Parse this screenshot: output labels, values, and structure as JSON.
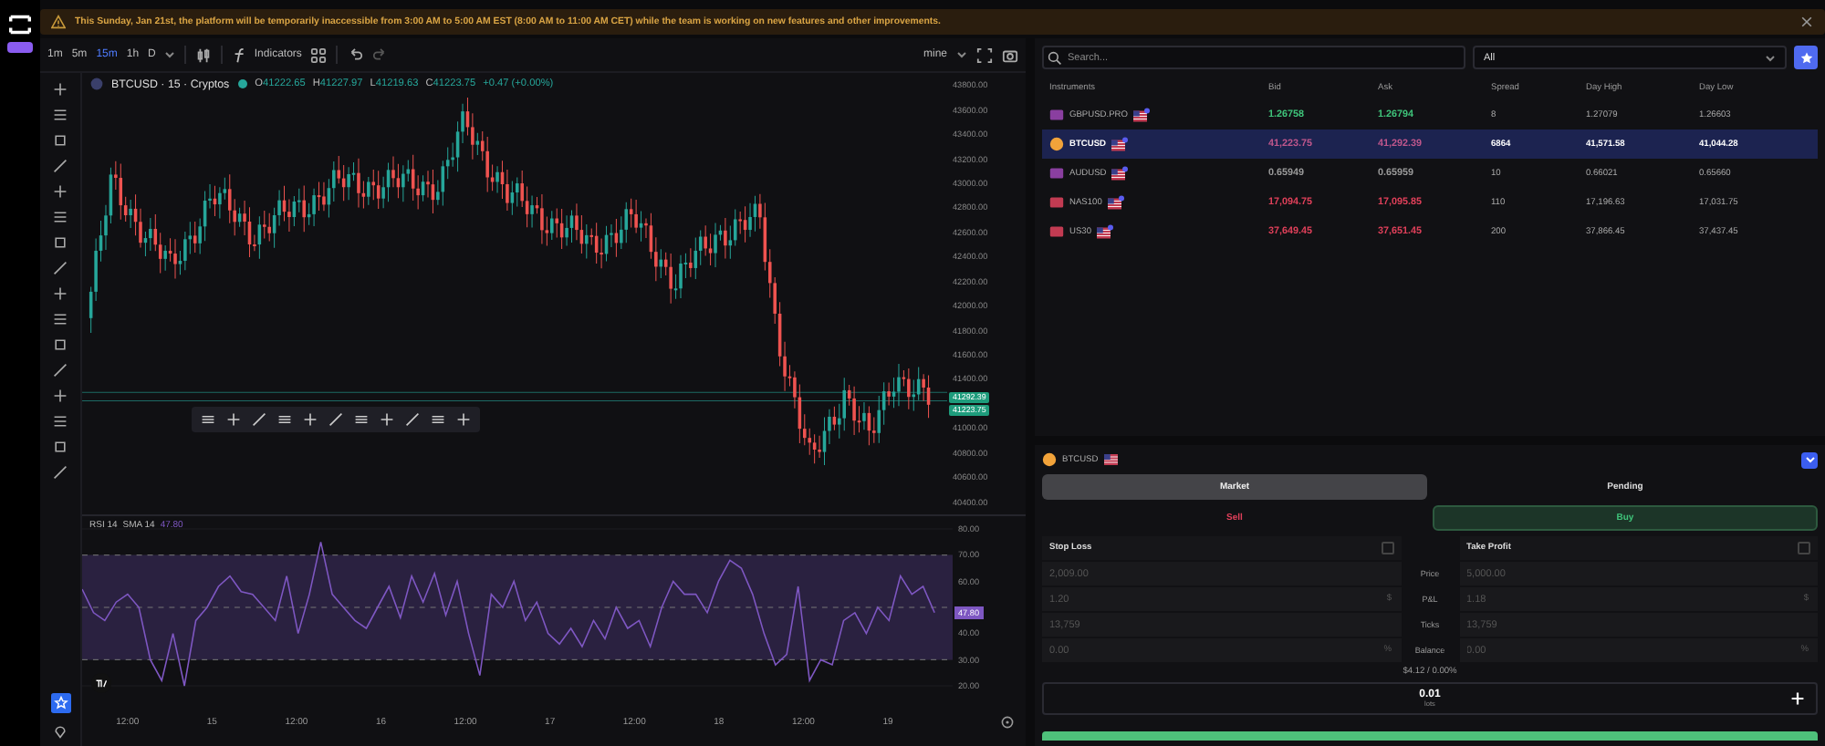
{
  "banner": {
    "message": "This Sunday, Jan 21st, the platform will be temporarily inaccessible from 3:00 AM to 5:00 AM EST (8:00 AM to 11:00 AM CET) while the team is working on new features and other improvements."
  },
  "chart": {
    "timeframes": [
      {
        "label": "1m",
        "selected": false
      },
      {
        "label": "5m",
        "selected": false
      },
      {
        "label": "15m",
        "selected": true
      },
      {
        "label": "1h",
        "selected": false
      },
      {
        "label": "D",
        "selected": false
      }
    ],
    "indicators_label": "Indicators",
    "chart_type": "mine",
    "symbol": "BTCUSD · 15 · Cryptos",
    "ohlc": [
      {
        "key": "O",
        "value": "41222.65"
      },
      {
        "key": "H",
        "value": "41227.97"
      },
      {
        "key": "L",
        "value": "41219.63"
      },
      {
        "key": "C",
        "value": "41223.75"
      }
    ],
    "change": "+0.47 (+0.00%)",
    "price_axis": [
      {
        "kind": "tick",
        "label": "43800.00"
      },
      {
        "kind": "tick",
        "label": "43600.00"
      },
      {
        "kind": "tick",
        "label": "43400.00"
      },
      {
        "kind": "tick",
        "label": "43200.00"
      },
      {
        "kind": "tick",
        "label": "43000.00"
      },
      {
        "kind": "tick",
        "label": "42800.00"
      },
      {
        "kind": "tick",
        "label": "42600.00"
      },
      {
        "kind": "tick",
        "label": "42400.00"
      },
      {
        "kind": "tick",
        "label": "42200.00"
      },
      {
        "kind": "tick",
        "label": "42000.00"
      },
      {
        "kind": "tick",
        "label": "41800.00"
      },
      {
        "kind": "tick",
        "label": "41600.00"
      },
      {
        "kind": "tick",
        "label": "41400.00"
      },
      {
        "kind": "price_tag",
        "label": "41292.39"
      },
      {
        "kind": "price_tag",
        "label": "41223.75"
      },
      {
        "kind": "tick",
        "label": "41000.00"
      },
      {
        "kind": "tick",
        "label": "40800.00"
      },
      {
        "kind": "tick",
        "label": "40600.00"
      },
      {
        "kind": "tick",
        "label": "40400.00"
      }
    ],
    "rsi": {
      "label": "SMA 14",
      "value": "47.80",
      "tag": "47.80",
      "chart_data": {
        "type": "line",
        "grid": true,
        "ylim": [
          20,
          80
        ],
        "yticks": [
          {
            "value": 80,
            "label": "80.00"
          },
          {
            "value": 70,
            "label": "70.00"
          },
          {
            "value": 60,
            "label": "60.00"
          },
          {
            "value": 40,
            "label": "40.00"
          },
          {
            "value": 30,
            "label": "30.00"
          },
          {
            "value": 20,
            "label": "20.00"
          }
        ],
        "series": [
          {
            "name": "RSI 14",
            "color": "#7e57c2",
            "values": [
              57,
              48,
              45,
              52,
              55,
              50,
              30,
              22,
              40,
              20,
              45,
              50,
              58,
              62,
              56,
              55,
              50,
              45,
              62,
              40,
              55,
              75,
              55,
              50,
              45,
              42,
              50,
              58,
              46,
              62,
              52,
              63,
              47,
              60,
              40,
              24,
              55,
              50,
              60,
              45,
              52,
              40,
              36,
              42,
              35,
              45,
              38,
              50,
              42,
              45,
              35,
              50,
              60,
              55,
              55,
              48,
              60,
              68,
              65,
              55,
              40,
              28,
              32,
              58,
              22,
              30,
              28,
              45,
              48,
              40,
              50,
              45,
              62,
              55,
              58,
              48
            ]
          }
        ]
      }
    },
    "time_axis": [
      "12:00",
      "15",
      "12:00",
      "16",
      "12:00",
      "17",
      "12:00",
      "18",
      "12:00",
      "19"
    ]
  },
  "instruments": {
    "search_placeholder": "Search...",
    "filter": "All",
    "columns": [
      "Instruments",
      "Bid",
      "Ask",
      "Spread",
      "Day High",
      "Day Low"
    ],
    "rows": [
      {
        "symbol": "GBPUSD.PRO",
        "kind": "forex",
        "color": "#3fc47a",
        "bid": "1.26758",
        "ask": "1.26794",
        "spread": "8",
        "day_high": "1.27079",
        "day_low": "1.26603",
        "selected": false
      },
      {
        "symbol": "BTCUSD",
        "kind": "crypto",
        "color": "#c0578c",
        "bid": "41,223.75",
        "ask": "41,292.39",
        "spread": "6864",
        "day_high": "41,571.58",
        "day_low": "41,044.28",
        "selected": true
      },
      {
        "symbol": "AUDUSD",
        "kind": "forex",
        "color": "#9a9a9a",
        "bid": "0.65949",
        "ask": "0.65959",
        "spread": "10",
        "day_high": "0.66021",
        "day_low": "0.65660",
        "selected": false
      },
      {
        "symbol": "NAS100",
        "kind": "index",
        "color": "#e0405a",
        "bid": "17,094.75",
        "ask": "17,095.85",
        "spread": "110",
        "day_high": "17,196.63",
        "day_low": "17,031.75",
        "selected": false
      },
      {
        "symbol": "US30",
        "kind": "index",
        "color": "#e0405a",
        "bid": "37,649.45",
        "ask": "37,651.45",
        "spread": "200",
        "day_high": "37,866.45",
        "day_low": "37,437.45",
        "selected": false
      }
    ]
  },
  "order": {
    "symbol": "BTCUSD",
    "order_types": [
      {
        "label": "Market",
        "selected": true
      },
      {
        "label": "Pending",
        "selected": false
      }
    ],
    "sides": [
      {
        "label": "Sell",
        "kind": "sell",
        "selected": false
      },
      {
        "label": "Buy",
        "kind": "buy",
        "selected": true
      }
    ],
    "stop_loss": {
      "label": "Stop Loss",
      "checked": false,
      "fields": [
        {
          "placeholder": "2,009.00"
        },
        {
          "placeholder": "1.20",
          "unit": "$"
        },
        {
          "placeholder": "13,759"
        },
        {
          "placeholder": "0.00",
          "unit": "%"
        }
      ]
    },
    "take_profit": {
      "label": "Take Profit",
      "checked": false,
      "fields": [
        {
          "placeholder": "5,000.00"
        },
        {
          "placeholder": "1.18",
          "unit": "$"
        },
        {
          "placeholder": "13,759"
        },
        {
          "placeholder": "0.00",
          "unit": "%"
        }
      ]
    },
    "row_labels": [
      "Price",
      "P&L",
      "Ticks",
      "Balance"
    ],
    "summary": "$4.12 / 0.00%",
    "lot": {
      "value": "0.01",
      "label": "lots"
    }
  }
}
